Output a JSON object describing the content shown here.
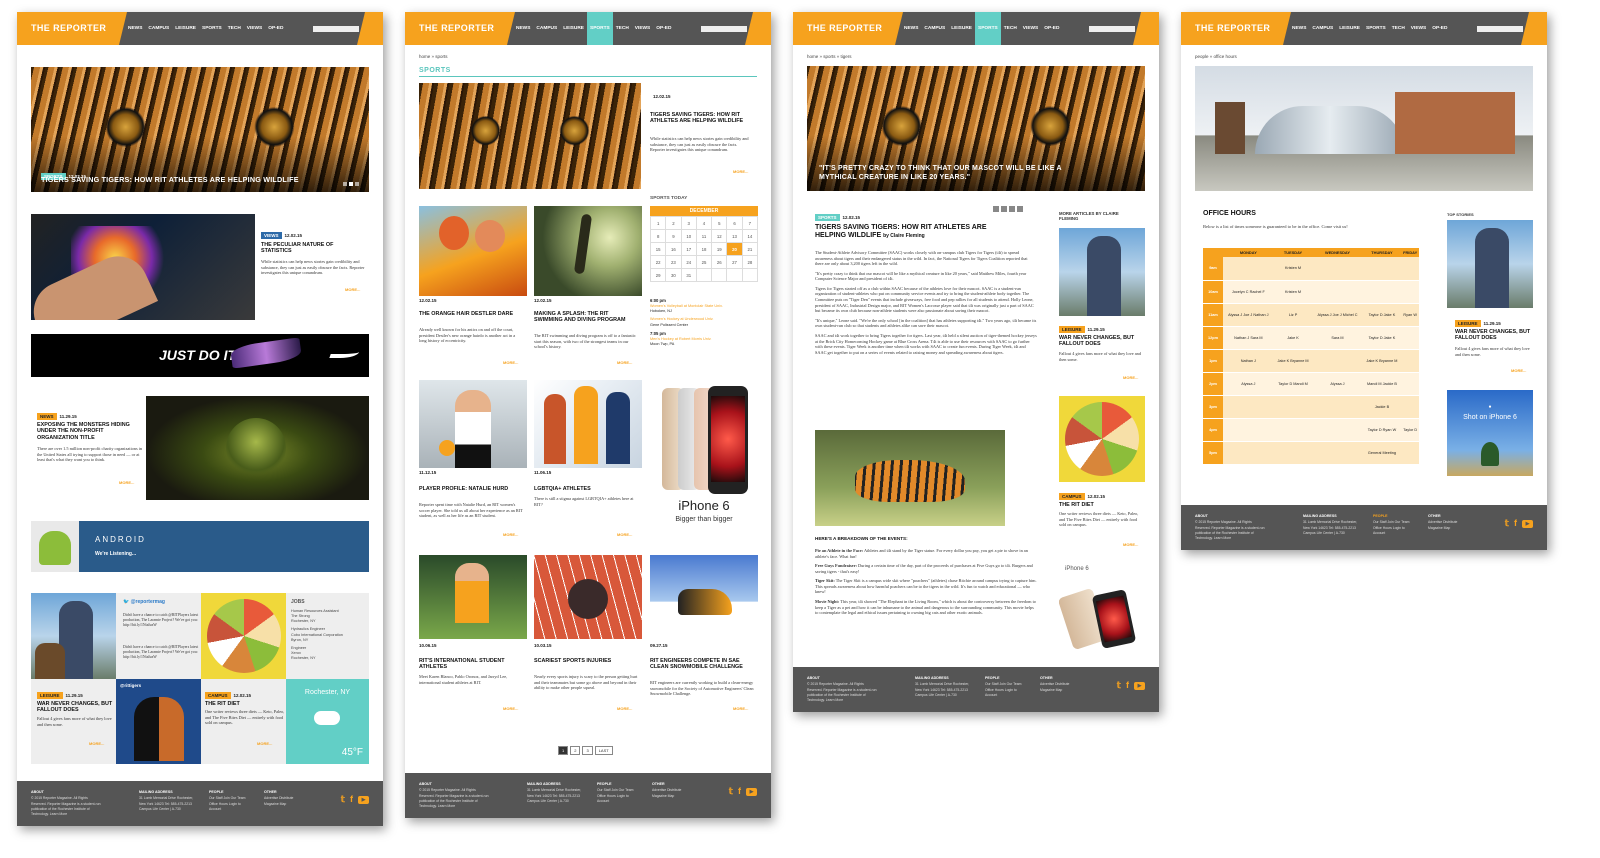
{
  "site": {
    "logo": "THE REPORTER",
    "nav": [
      "NEWS",
      "CAMPUS",
      "LEISURE",
      "SPORTS",
      "TECH",
      "VIEWS",
      "OP-ED"
    ]
  },
  "home": {
    "hero": {
      "tag": "SPORTS",
      "date": "12.02.15",
      "title": "TIGERS SAVING TIGERS: HOW RIT ATHLETES ARE HELPING WILDLIFE"
    },
    "article1": {
      "tag": "VIEWS",
      "date": "12.02.15",
      "title": "THE PECULIAR NATURE OF STATISTICS",
      "text": "While statistics can help news stories gain credibility and substance, they can just as easily obscure the facts. Reporter investigates this unique conundrum.",
      "more": "MORE..."
    },
    "nike_ad": "JUST DO IT.",
    "article2": {
      "tag": "NEWS",
      "date": "11.29.15",
      "title": "EXPOSING THE MONSTERS HIDING UNDER THE NON-PROFIT ORGANIZATION TITLE",
      "text": "There are over 1.5 million non-profit charity organizations in the United States all trying to support those in need — or at least that's what they want you to think.",
      "more": "MORE..."
    },
    "android": {
      "brand": "ANDROID",
      "sub": "We're Listening..."
    },
    "twitter": {
      "handle1": "@reportermag",
      "handle2": "@rittigers",
      "tweet": "Didn't have a chance to catch @RITPlayers latest production, The Laramie Project? We've got you: http://bit.ly/1NtaIuzW"
    },
    "jobs": {
      "title": "JOBS",
      "items": [
        {
          "role": "Human Resources Assistant",
          "co": "The Strong",
          "loc": "Rochester, NY"
        },
        {
          "role": "Hydraulics Engineer",
          "co": "Cobo International Corporation",
          "loc": "Byron, NY"
        },
        {
          "role": "Engineer",
          "co": "Xerox",
          "loc": "Rochester, NY"
        }
      ]
    },
    "leisure": {
      "tag": "LEISURE",
      "date": "11.29.15",
      "title": "WAR NEVER CHANGES, BUT FALLOUT DOES",
      "text": "Fallout 4 gives fans more of what they love and then some.",
      "more": "MORE..."
    },
    "campus": {
      "tag": "CAMPUS",
      "date": "12.02.15",
      "title": "THE RIT DIET",
      "text": "One writer reviews three diets — Keto, Paleo, and The Five Bites Diet — entirely with food sold on campus.",
      "more": "MORE..."
    },
    "weather": {
      "city": "Rochester, NY",
      "temp": "45°F"
    }
  },
  "sports": {
    "crumb": "home » sports",
    "section": "SPORTS",
    "feature": {
      "date": "12.02.15",
      "title": "TIGERS SAVING TIGERS: HOW RIT ATHLETES ARE HELPING WILDLIFE",
      "text": "While statistics can help news stories gain credibility and substance, they can just as easily obscure the facts. Reporter investigates this unique conundrum.",
      "more": "MORE..."
    },
    "today": "SPORTS TODAY",
    "month": "DECEMBER",
    "days": [
      "1",
      "2",
      "3",
      "4",
      "5",
      "6",
      "7",
      "8",
      "9",
      "10",
      "11",
      "12",
      "13",
      "14",
      "15",
      "16",
      "17",
      "18",
      "19",
      "20",
      "21",
      "22",
      "23",
      "24",
      "25",
      "26",
      "27",
      "28",
      "29",
      "30",
      "31",
      "",
      "",
      "",
      ""
    ],
    "today_day": "20",
    "events": [
      {
        "time": "6:00 pm",
        "name": "Women's Volleyball at Montclair State Univ.",
        "loc": "Hoboken, NJ"
      },
      {
        "time": "",
        "name": "Women's Hockey at Underwood Univ.",
        "loc": "Gene Polisseni Center"
      },
      {
        "time": "7:05 pm",
        "name": "Men's Hockey at Robert Morris Univ.",
        "loc": "Moon Twp, PA"
      }
    ],
    "cards": [
      {
        "date": "12.02.15",
        "title": "THE ORANGE HAIR DESTLER DARE",
        "text": "Already well known for his antics on and off the court, president Destler's new orange hairdo is another act in a long history of eccentricity."
      },
      {
        "date": "12.02.15",
        "title": "MAKING A SPLASH: THE RIT SWIMMING AND DIVING PROGRAM",
        "text": "The RIT swimming and diving program is off to a fantastic start this season, with two of the strongest teams in our school's history."
      },
      {
        "date": "11.12.15",
        "title": "PLAYER PROFILE: NATALIE HURD",
        "text": "Reporter spent time with Natalie Hurd, an RIT women's soccer player. She told us all about her experience as an RIT student, as well as her life as an RIT student."
      },
      {
        "date": "11.06.15",
        "title": "LGBTQIA+ ATHLETES",
        "text": "There is still a stigma against LGBTQIA+ athletes here at RIT?"
      },
      {
        "date": "10.06.15",
        "title": "RIT'S INTERNATIONAL STUDENT ATHLETES",
        "text": "Meet Karen Blanco, Pablo Oronoz, and Jarryd Lee, international student athletes at RIT."
      },
      {
        "date": "10.03.15",
        "title": "SCARIEST SPORTS INJURIES",
        "text": "Nearly every sports injury is scary to the person getting hurt and their teammates but some go above and beyond in their ability to make other people squeal."
      },
      {
        "date": "09.27.15",
        "title": "RIT ENGINEERS COMPETE IN SAE CLEAN SNOWMOBILE CHALLENGE",
        "text": "RIT engineers are currently working to build a clean-energy snowmobile for the Society of Automotive Engineers' Clean Snowmobile Challenge."
      }
    ],
    "iphone": {
      "name": "iPhone 6",
      "slogan": "Bigger than bigger"
    },
    "pages": [
      "1",
      "2",
      "3",
      "LAST"
    ]
  },
  "article": {
    "crumb": "home » sports » tigers",
    "quote": "\"IT'S PRETTY CRAZY TO THINK THAT OUR MASCOT WILL BE LIKE A MYTHICAL CREATURE IN LIKE 20 YEARS.\"",
    "tag": "SPORTS",
    "date": "12.02.15",
    "title": "TIGERS SAVING TIGERS: HOW RIT ATHLETES ARE HELPING WILDLIFE",
    "byline": "by Claire Fleming",
    "p1": "The Student-Athlete Advisory Committee (SAAC) works closely with on-campus club Tigers for Tigers (t4t) to spread awareness about tigers and their endangered status in the wild. In fact, the National Tigers for Tigers Coalition reported that there are only about 3,200 tigers left in the wild.",
    "p2": "\"It's pretty crazy to think that our mascot will be like a mythical creature in like 20 years,\" said Matthew Miles, fourth year Computer Science Major and president of t4t.",
    "p3": "Tigers for Tigers started off as a club within SAAC because of the athletes love for their mascot. SAAC is a student-run organization of student-athletes who put on community service events and try to bring the student-athlete body together. The Committee puts on \"Tiger Den\" events that include giveaways, free food and pep rallies for all students to attend. Holly Leone, president of SAAC, Industrial Design major, and RIT Women's Lacrosse player said that t4t was originally just a part of SAAC but became its own club because non-athlete students were also passionate about saving their mascot.",
    "p4": "\"It's unique,\" Leone said. \"We're the only school [in the coalition] that has athletes supporting t4t.\" Two years ago, t4t became its own student-run club so that students and athletes alike can save their mascot.",
    "p5": "SAAC and t4t work together to bring Tigers together for tigers. Last year, t4t held a silent auction of tiger-themed hockey jerseys at the Brick City Homecoming Hockey game at Blue Cross Arena. T4t is able to use their resources with SAAC to go further with these events. Tiger Week is another time when t4t works with SAAC to create fun events. During Tiger Week, t4t and SAAC get together to put on a series of events related to raising money and spreading awareness about tigers.",
    "breakdown": "HERE'S A BREAKDOWN OF THE EVENTS:",
    "events": [
      {
        "name": "Pie an Athlete in the Face:",
        "text": "Athletes and t4t stand by the Tiger statue. For every dollar you pay, you get a pie to shove in an athlete's face. What fun!"
      },
      {
        "name": "Free Guys Fundraiser:",
        "text": "During a certain time of the day, part of the proceeds of purchases at Five Guys go to t4t. Burgers and saving tigers - that's easy!"
      },
      {
        "name": "Tiger Skit:",
        "text": "The Tiger Skit is a campus wide skit where \"poachers\" (athletes) chase Ritchie around campus trying to capture him. This spreads awareness about how harmful poachers can be to the tigers in the wild. It's fun to watch and educational — who knew!"
      },
      {
        "name": "Movie Night:",
        "text": "This year, t4t showed \"The Elephant in the Living Room,\" which is about the controversy between the freedom to keep a Tiger as a pet and how it can be inhumane to the animal and dangerous to the surrounding community. This movie helps to contemplate the legal and ethical issues pertaining to owning big cats and other exotic animals."
      }
    ],
    "more_title": "MORE ARTICLES BY CLAIRE FLEMING",
    "side1": {
      "tag": "LEISURE",
      "date": "11.29.15",
      "title": "WAR NEVER CHANGES, BUT FALLOUT DOES",
      "text": "Fallout 4 gives fans more of what they love and then some.",
      "more": "MORE..."
    },
    "side2": {
      "tag": "CAMPUS",
      "date": "12.02.15",
      "title": "THE RIT DIET",
      "text": "One writer reviews three diets — Keto, Paleo, and The Five Bites Diet — entirely with food sold on campus.",
      "more": "MORE..."
    }
  },
  "office": {
    "crumb": "people » office hours",
    "title": "OFFICE HOURS",
    "intro": "Below is a list of times someone is guaranteed to be in the office. Come visit us!",
    "days": [
      "MONDAY",
      "TUESDAY",
      "WEDNESDAY",
      "THURSDAY",
      "FRIDAY"
    ],
    "rows": [
      {
        "t": "9am",
        "c": [
          "",
          "Kristen M",
          "",
          "",
          ""
        ]
      },
      {
        "t": "10am",
        "c": [
          "Jocelyn C Rachel F",
          "Kristen M",
          "",
          "",
          ""
        ]
      },
      {
        "t": "11am",
        "c": [
          "Alyssa J Joe J Nathan J",
          "Liz P",
          "Alyssa J Joe J Michel C",
          "Taylor D Jake K",
          "Ryan W"
        ]
      },
      {
        "t": "12pm",
        "c": [
          "Nathan J Sara M",
          "Jake K",
          "Sara M",
          "Taylor D Jake K",
          "",
          ""
        ]
      },
      {
        "t": "1pm",
        "c": [
          "Nathan J",
          "Jake K Bryanne M",
          "",
          "Jake K Bryanne M",
          ""
        ]
      },
      {
        "t": "2pm",
        "c": [
          "Alyssa J",
          "Taylor D Mandi M",
          "Alyssa J",
          "Mandi M Jackie B",
          ""
        ]
      },
      {
        "t": "3pm",
        "c": [
          "",
          "",
          "",
          "Jackie B",
          ""
        ]
      },
      {
        "t": "4pm",
        "c": [
          "",
          "",
          "",
          "Taylor D Ryan W",
          "Taylor D"
        ]
      },
      {
        "t": "5pm",
        "c": [
          "",
          "",
          "",
          "General Meeting",
          ""
        ]
      }
    ],
    "top": "TOP STORIES",
    "story": {
      "tag": "LEISURE",
      "date": "11.29.15",
      "title": "WAR NEVER CHANGES, BUT FALLOUT DOES",
      "text": "Fallout 4 gives fans more of what they love and then some.",
      "more": "MORE..."
    },
    "iphone_ad": "Shot on iPhone 6"
  },
  "footer": {
    "about": "ABOUT",
    "about_text": "© 2015 Reporter Magazine. All Rights Reserved. Reporter Magazine is a student-run publication of the Rochester Institute of Technology. Learn More",
    "mail": "MAILING ADDRESS",
    "mail_text": "31 Lomb Memorial Drive Rochester, New York 14623 Tel: 585-475-2213 Campus Life Center | A-730",
    "people": "PEOPLE",
    "people_items": "Our Staff  Join Our Team  Office Hours  Login to Account",
    "other": "OTHER",
    "other_items": "Advertise  Distribute  Magazine Map"
  },
  "colors": {
    "accent": "#f6a21e",
    "teal": "#62cfc6",
    "dark": "#555555"
  }
}
